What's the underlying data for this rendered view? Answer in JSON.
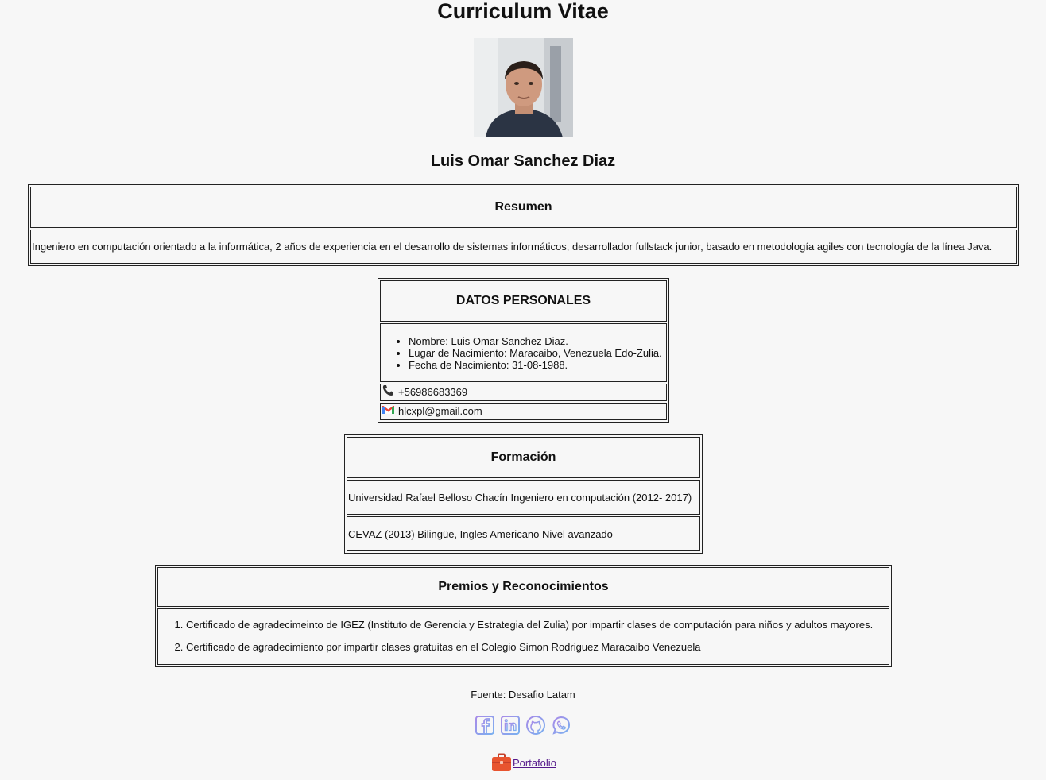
{
  "header": {
    "title": "Curriculum Vitae",
    "photo_icon": "profile-photo",
    "name": "Luis Omar Sanchez Diaz"
  },
  "resumen": {
    "heading": "Resumen",
    "text": "Ingeniero en computación orientado a la informática, 2 años de experiencia en el desarrollo de sistemas informáticos, desarrollador fullstack junior, basado en metodología agiles con tecnología de la línea Java."
  },
  "datos": {
    "heading": "DATOS PERSONALES",
    "items": [
      "Nombre: Luis Omar Sanchez Diaz.",
      "Lugar de Nacimiento: Maracaibo, Venezuela Edo-Zulia.",
      "Fecha de Nacimiento: 31-08-1988."
    ],
    "phone": "+56986683369",
    "email": "hlcxpl@gmail.com",
    "phone_icon": "phone-icon",
    "email_icon": "gmail-icon"
  },
  "formacion": {
    "heading": "Formación",
    "rows": [
      "Universidad Rafael Belloso Chacín Ingeniero en computación (2012- 2017)",
      "CEVAZ (2013) Bilingüe, Ingles Americano Nivel avanzado"
    ]
  },
  "premios": {
    "heading": "Premios y Reconocimientos",
    "items": [
      "Certificado de agradecimeinto de IGEZ (Instituto de Gerencia y Estrategia del Zulia) por impartir clases de computación para niños y adultos mayores.",
      "Certificado de agradecimiento por impartir clases gratuitas en el Colegio Simon Rodriguez Maracaibo Venezuela"
    ]
  },
  "footer": {
    "source": "Fuente: Desafio Latam",
    "social_icons": [
      "facebook-icon",
      "linkedin-icon",
      "github-icon",
      "whatsapp-icon"
    ],
    "portfolio_label": "Portafolio",
    "portfolio_icon": "briefcase-icon"
  },
  "colors": {
    "background": "#f7f7f7",
    "text": "#111111",
    "border": "#222222",
    "visited_link": "#551a8b",
    "social_gradient_start": "#a88be8",
    "social_gradient_end": "#7ab0f0",
    "briefcase": "#e8542f"
  }
}
